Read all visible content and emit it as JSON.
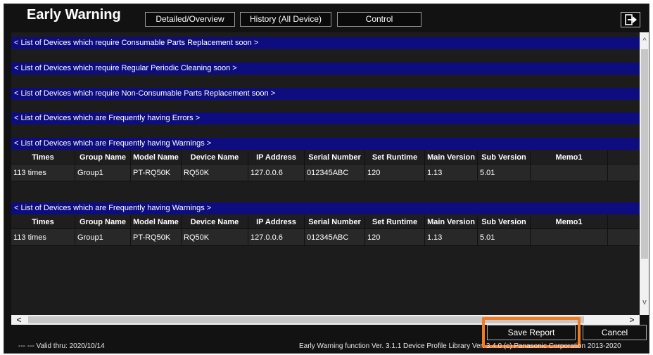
{
  "header": {
    "title": "Early Warning",
    "tabs": [
      {
        "label": "Detailed/Overview"
      },
      {
        "label": "History (All Device)"
      },
      {
        "label": "Control"
      }
    ],
    "exit_icon": "exit-icon"
  },
  "sections": [
    {
      "title": "< List of Devices which require Consumable Parts Replacement soon >"
    },
    {
      "title": "< List of Devices which require Regular Periodic Cleaning soon >"
    },
    {
      "title": "< List of Devices which require Non-Consumable Parts Replacement soon >"
    },
    {
      "title": "< List of Devices which are Frequently having Errors >"
    },
    {
      "title": "< List of Devices which are Frequently having Warnings >"
    },
    {
      "title": "< List of Devices which are Frequently having Warnings >"
    }
  ],
  "table": {
    "columns": [
      "Times",
      "Group Name",
      "Model Name",
      "Device Name",
      "IP Address",
      "Serial Number",
      "Set Runtime",
      "Main Version",
      "Sub Version",
      "Memo1",
      ""
    ],
    "rows": [
      [
        "113 times",
        "Group1",
        "PT-RQ50K",
        "RQ50K",
        "127.0.0.6",
        "012345ABC",
        "120",
        "1.13",
        "5.01",
        "",
        ""
      ],
      [
        "113 times",
        "Group1",
        "PT-RQ50K",
        "RQ50K",
        "127.0.0.6",
        "012345ABC",
        "120",
        "1.13",
        "5.01",
        "",
        ""
      ]
    ]
  },
  "scrollbars": {
    "up": "^",
    "down": "v",
    "left": "<",
    "right": ">"
  },
  "footer": {
    "save_label": "Save Report",
    "cancel_label": "Cancel",
    "valid_text": "--- --- Valid thru: 2020/10/14",
    "version_text": "Early Warning function Ver. 3.1.1   Device Profile Library Ver. 3.4.0   (c) Panasonic Corporation 2013-2020"
  },
  "colors": {
    "section_header": "#0d0d80",
    "highlight": "#f47a20",
    "background": "#121212"
  }
}
